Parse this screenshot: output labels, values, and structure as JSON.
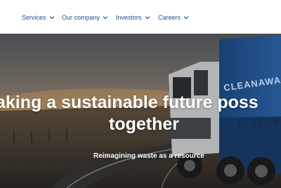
{
  "nav": {
    "items": [
      {
        "label": "Services",
        "icon": "chevron-down-icon"
      },
      {
        "label": "Our company",
        "icon": "chevron-down-icon"
      },
      {
        "label": "Investors",
        "icon": "chevron-down-icon"
      },
      {
        "label": "Careers",
        "icon": "chevron-down-icon"
      }
    ],
    "color": "#1f4f8f"
  },
  "hero": {
    "title_line1": "aking a sustainable future poss",
    "title_line2": "together",
    "subtitle": "Reimagining waste as a resource",
    "truck_brand": "CLEANAWA",
    "truck_phone": "13 13 39"
  }
}
